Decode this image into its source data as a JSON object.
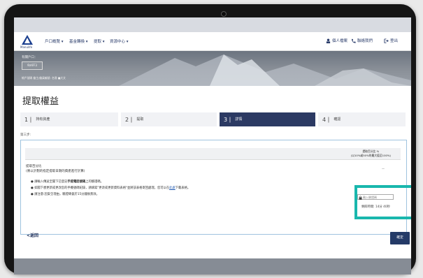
{
  "nav": {
    "logo_text": "Manulife",
    "menu": [
      "戶口概覽",
      "基金轉換",
      "提取",
      "資源中心"
    ],
    "right": [
      "個人檔案",
      "聯絡我們",
      "登出"
    ]
  },
  "banner": {
    "label": "有關戶口：",
    "account": "9\\AFF3",
    "info": "帳戶號碼 僱主/僱員編號: 名冊 ■大文"
  },
  "page_title": "提取權益",
  "steps": [
    {
      "num": "1",
      "label": "持有資產"
    },
    {
      "num": "2",
      "label": "提取"
    },
    {
      "num": "3",
      "label": "詳情"
    },
    {
      "num": "4",
      "label": "確認"
    }
  ],
  "step_note": "第三步:",
  "card": {
    "col_header_1": "提取百分比 %",
    "col_header_2": "(以10%或50%的最大值至100%)",
    "section_title_1": "提取百分比",
    "section_title_2": "(將以計劃的指定提取日期的資產進行計算)",
    "dash": "—",
    "bullets": [
      {
        "pre": "請輸入傳送至閣下已登記",
        "emph": "手提電話號碼",
        "post": "上的驗證碼。"
      },
      {
        "pre": "如閣下想更新或更改您的手機號碼紀錄，請填寫\"更改或更新資料表格\"並將該表格寄回處理。您可以在",
        "link": "此處",
        "post": "下載表格。"
      },
      {
        "pre": "請注意:因安全理由，驗證碼會於15分鐘後無效。",
        "emph": "",
        "post": ""
      }
    ],
    "input_placeholder": "輸入驗證碼",
    "timer": "剩餘時間: 14分 40秒"
  },
  "actions": {
    "back": "<返回",
    "confirm": "確定"
  },
  "colors": {
    "primary": "#2c3a63",
    "highlight": "#19b7ad"
  }
}
